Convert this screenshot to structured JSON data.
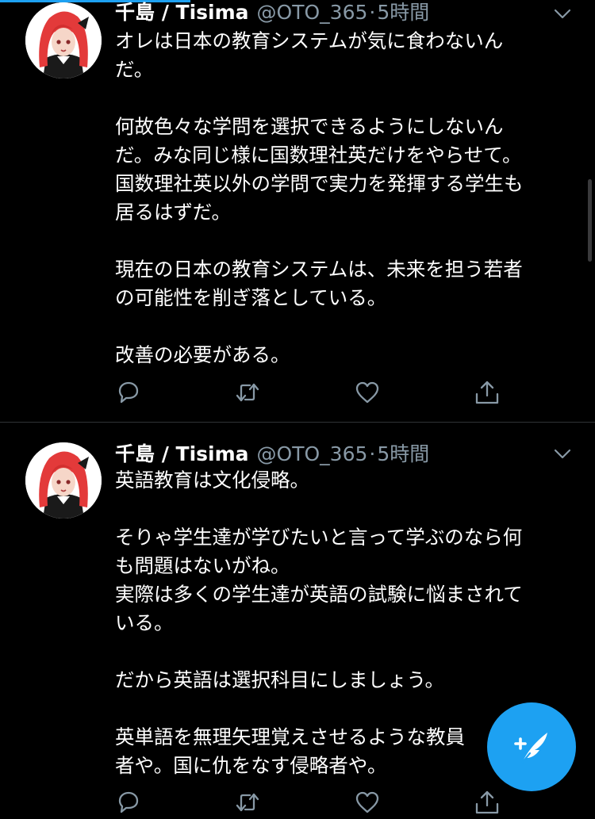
{
  "tweets": [
    {
      "author_name": "千島 / Tisima",
      "handle": "@OTO_365",
      "separator": "·",
      "time": "5時間",
      "lines": [
        "オレは日本の教育システムが気に食わないん",
        "だ。",
        "",
        "何故色々な学問を選択できるようにしないん",
        "だ。みな同じ様に国数理社英だけをやらせて。",
        "国数理社英以外の学問で実力を発揮する学生も",
        "居るはずだ。",
        "",
        "現在の日本の教育システムは、未来を担う若者",
        "の可能性を削ぎ落としている。",
        "",
        "改善の必要がある。"
      ]
    },
    {
      "author_name": "千島 / Tisima",
      "handle": "@OTO_365",
      "separator": "·",
      "time": "5時間",
      "lines": [
        "英語教育は文化侵略。",
        "",
        "そりゃ学生達が学びたいと言って学ぶのなら何",
        "も問題はないがね。",
        "実際は多くの学生達が英語の試験に悩まされて",
        "いる。",
        "",
        "だから英語は選択科目にしましょう。",
        "",
        "英単語を無理矢理覚えさせるような教員",
        "者や。国に仇をなす侵略者や。"
      ]
    }
  ],
  "icons": {
    "reply": "reply-icon",
    "retweet": "retweet-icon",
    "like": "heart-icon",
    "share": "share-icon",
    "more": "chevron-down-icon",
    "compose": "compose-tweet-icon"
  },
  "colors": {
    "background": "#000000",
    "text_primary": "#ffffff",
    "text_secondary": "#8899a6",
    "accent": "#1da1f2",
    "divider": "#2f3336"
  }
}
